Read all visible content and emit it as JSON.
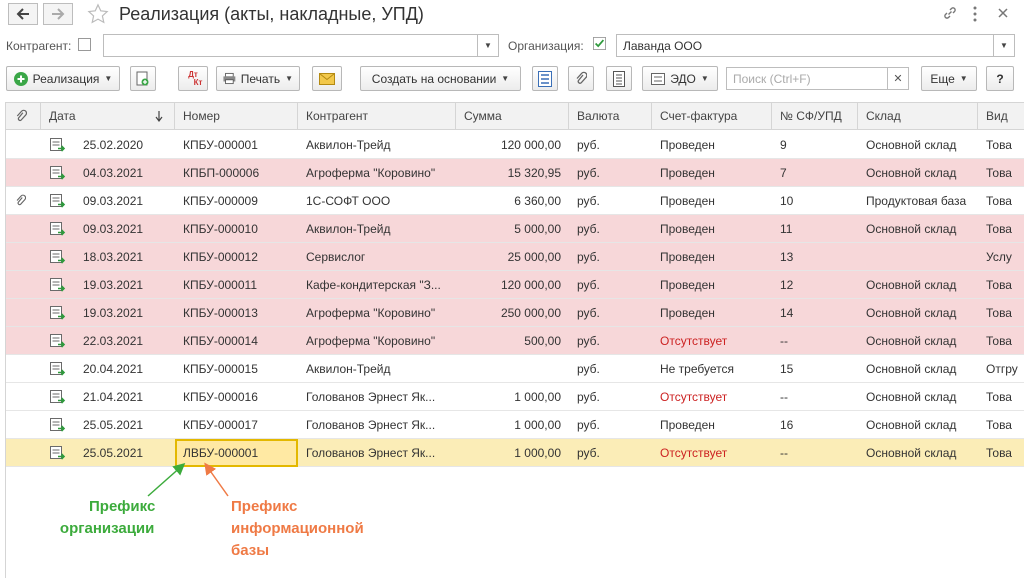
{
  "title": "Реализация (акты, накладные, УПД)",
  "filters": {
    "counterparty_label": "Контрагент:",
    "counterparty_value": "",
    "organization_label": "Организация:",
    "organization_value": "Лаванда ООО"
  },
  "toolbar": {
    "sale_label": "Реализация",
    "dtkt_top": "Дт",
    "dtkt_bottom": "Кт",
    "print_label": "Печать",
    "create_based_label": "Создать на основании",
    "edo_label": "ЭДО",
    "search_placeholder": "Поиск (Ctrl+F)",
    "more_label": "Еще",
    "help_label": "?"
  },
  "columns": [
    "Дата",
    "Номер",
    "Контрагент",
    "Сумма",
    "Валюта",
    "Счет-фактура",
    "№ СФ/УПД",
    "Склад",
    "Вид"
  ],
  "rows": [
    {
      "date": "25.02.2020",
      "number": "КПБУ-000001",
      "counterparty": "Аквилон-Трейд",
      "sum": "120 000,00",
      "currency": "руб.",
      "invoice": "Проведен",
      "sf_no": "9",
      "warehouse": "Основной склад",
      "kind": "Това",
      "style": "normal",
      "clip": false,
      "invoice_red": false
    },
    {
      "date": "04.03.2021",
      "number": "КПБП-000006",
      "counterparty": "Агроферма \"Коровино\"",
      "sum": "15 320,95",
      "currency": "руб.",
      "invoice": "Проведен",
      "sf_no": "7",
      "warehouse": "Основной склад",
      "kind": "Това",
      "style": "pink",
      "clip": false,
      "invoice_red": false
    },
    {
      "date": "09.03.2021",
      "number": "КПБУ-000009",
      "counterparty": "1С-СОФТ ООО",
      "sum": "6 360,00",
      "currency": "руб.",
      "invoice": "Проведен",
      "sf_no": "10",
      "warehouse": "Продуктовая база",
      "kind": "Това",
      "style": "normal",
      "clip": true,
      "invoice_red": false
    },
    {
      "date": "09.03.2021",
      "number": "КПБУ-000010",
      "counterparty": "Аквилон-Трейд",
      "sum": "5 000,00",
      "currency": "руб.",
      "invoice": "Проведен",
      "sf_no": "11",
      "warehouse": "Основной склад",
      "kind": "Това",
      "style": "pink",
      "clip": false,
      "invoice_red": false
    },
    {
      "date": "18.03.2021",
      "number": "КПБУ-000012",
      "counterparty": "Сервислог",
      "sum": "25 000,00",
      "currency": "руб.",
      "invoice": "Проведен",
      "sf_no": "13",
      "warehouse": "",
      "kind": "Услу",
      "style": "pink",
      "clip": false,
      "invoice_red": false
    },
    {
      "date": "19.03.2021",
      "number": "КПБУ-000011",
      "counterparty": "Кафе-кондитерская \"З...",
      "sum": "120 000,00",
      "currency": "руб.",
      "invoice": "Проведен",
      "sf_no": "12",
      "warehouse": "Основной склад",
      "kind": "Това",
      "style": "pink",
      "clip": false,
      "invoice_red": false
    },
    {
      "date": "19.03.2021",
      "number": "КПБУ-000013",
      "counterparty": "Агроферма \"Коровино\"",
      "sum": "250 000,00",
      "currency": "руб.",
      "invoice": "Проведен",
      "sf_no": "14",
      "warehouse": "Основной склад",
      "kind": "Това",
      "style": "pink",
      "clip": false,
      "invoice_red": false
    },
    {
      "date": "22.03.2021",
      "number": "КПБУ-000014",
      "counterparty": "Агроферма \"Коровино\"",
      "sum": "500,00",
      "currency": "руб.",
      "invoice": "Отсутствует",
      "sf_no": "--",
      "warehouse": "Основной склад",
      "kind": "Това",
      "style": "pink",
      "clip": false,
      "invoice_red": true
    },
    {
      "date": "20.04.2021",
      "number": "КПБУ-000015",
      "counterparty": "Аквилон-Трейд",
      "sum": "",
      "currency": "руб.",
      "invoice": "Не требуется",
      "sf_no": "15",
      "warehouse": "Основной склад",
      "kind": "Отгру",
      "style": "normal",
      "clip": false,
      "invoice_red": false
    },
    {
      "date": "21.04.2021",
      "number": "КПБУ-000016",
      "counterparty": "Голованов Эрнест Як...",
      "sum": "1 000,00",
      "currency": "руб.",
      "invoice": "Отсутствует",
      "sf_no": "--",
      "warehouse": "Основной склад",
      "kind": "Това",
      "style": "normal",
      "clip": false,
      "invoice_red": true
    },
    {
      "date": "25.05.2021",
      "number": "КПБУ-000017",
      "counterparty": "Голованов Эрнест Як...",
      "sum": "1 000,00",
      "currency": "руб.",
      "invoice": "Проведен",
      "sf_no": "16",
      "warehouse": "Основной склад",
      "kind": "Това",
      "style": "normal",
      "clip": false,
      "invoice_red": false
    },
    {
      "date": "25.05.2021",
      "number": "ЛВБУ-000001",
      "counterparty": "Голованов Эрнест Як...",
      "sum": "1 000,00",
      "currency": "руб.",
      "invoice": "Отсутствует",
      "sf_no": "--",
      "warehouse": "Основной склад",
      "kind": "Това",
      "style": "selected",
      "clip": false,
      "invoice_red": true
    }
  ],
  "annotations": {
    "org_prefix": [
      "Префикс",
      "организации"
    ],
    "ib_prefix": [
      "Префикс",
      "информационной",
      "базы"
    ]
  },
  "colors": {
    "pink_row": "#f7d7d9",
    "selected_row": "#fbedb7",
    "accent_green": "#3cab3c",
    "accent_orange": "#ef7a45",
    "red_text": "#cc2222"
  },
  "icons": [
    "back-icon",
    "forward-icon",
    "favorite-star-icon",
    "link-icon",
    "more-icon",
    "close-icon",
    "add-icon",
    "sort-down-icon",
    "clip-icon",
    "document-icon"
  ]
}
